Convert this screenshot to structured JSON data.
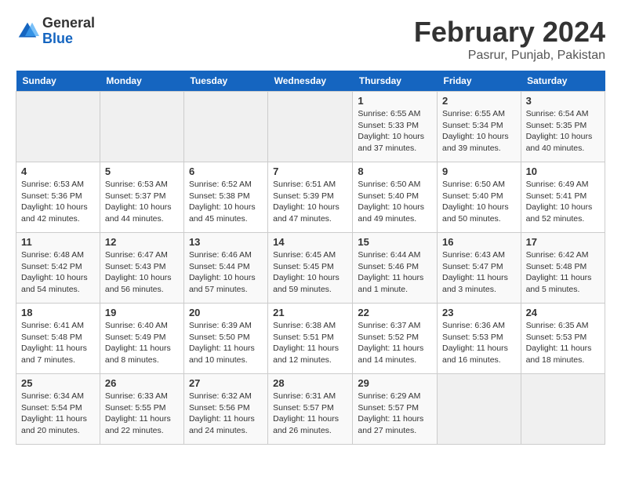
{
  "logo": {
    "general": "General",
    "blue": "Blue"
  },
  "title": "February 2024",
  "location": "Pasrur, Punjab, Pakistan",
  "headers": [
    "Sunday",
    "Monday",
    "Tuesday",
    "Wednesday",
    "Thursday",
    "Friday",
    "Saturday"
  ],
  "weeks": [
    [
      {
        "day": "",
        "info": ""
      },
      {
        "day": "",
        "info": ""
      },
      {
        "day": "",
        "info": ""
      },
      {
        "day": "",
        "info": ""
      },
      {
        "day": "1",
        "info": "Sunrise: 6:55 AM\nSunset: 5:33 PM\nDaylight: 10 hours\nand 37 minutes."
      },
      {
        "day": "2",
        "info": "Sunrise: 6:55 AM\nSunset: 5:34 PM\nDaylight: 10 hours\nand 39 minutes."
      },
      {
        "day": "3",
        "info": "Sunrise: 6:54 AM\nSunset: 5:35 PM\nDaylight: 10 hours\nand 40 minutes."
      }
    ],
    [
      {
        "day": "4",
        "info": "Sunrise: 6:53 AM\nSunset: 5:36 PM\nDaylight: 10 hours\nand 42 minutes."
      },
      {
        "day": "5",
        "info": "Sunrise: 6:53 AM\nSunset: 5:37 PM\nDaylight: 10 hours\nand 44 minutes."
      },
      {
        "day": "6",
        "info": "Sunrise: 6:52 AM\nSunset: 5:38 PM\nDaylight: 10 hours\nand 45 minutes."
      },
      {
        "day": "7",
        "info": "Sunrise: 6:51 AM\nSunset: 5:39 PM\nDaylight: 10 hours\nand 47 minutes."
      },
      {
        "day": "8",
        "info": "Sunrise: 6:50 AM\nSunset: 5:40 PM\nDaylight: 10 hours\nand 49 minutes."
      },
      {
        "day": "9",
        "info": "Sunrise: 6:50 AM\nSunset: 5:40 PM\nDaylight: 10 hours\nand 50 minutes."
      },
      {
        "day": "10",
        "info": "Sunrise: 6:49 AM\nSunset: 5:41 PM\nDaylight: 10 hours\nand 52 minutes."
      }
    ],
    [
      {
        "day": "11",
        "info": "Sunrise: 6:48 AM\nSunset: 5:42 PM\nDaylight: 10 hours\nand 54 minutes."
      },
      {
        "day": "12",
        "info": "Sunrise: 6:47 AM\nSunset: 5:43 PM\nDaylight: 10 hours\nand 56 minutes."
      },
      {
        "day": "13",
        "info": "Sunrise: 6:46 AM\nSunset: 5:44 PM\nDaylight: 10 hours\nand 57 minutes."
      },
      {
        "day": "14",
        "info": "Sunrise: 6:45 AM\nSunset: 5:45 PM\nDaylight: 10 hours\nand 59 minutes."
      },
      {
        "day": "15",
        "info": "Sunrise: 6:44 AM\nSunset: 5:46 PM\nDaylight: 11 hours\nand 1 minute."
      },
      {
        "day": "16",
        "info": "Sunrise: 6:43 AM\nSunset: 5:47 PM\nDaylight: 11 hours\nand 3 minutes."
      },
      {
        "day": "17",
        "info": "Sunrise: 6:42 AM\nSunset: 5:48 PM\nDaylight: 11 hours\nand 5 minutes."
      }
    ],
    [
      {
        "day": "18",
        "info": "Sunrise: 6:41 AM\nSunset: 5:48 PM\nDaylight: 11 hours\nand 7 minutes."
      },
      {
        "day": "19",
        "info": "Sunrise: 6:40 AM\nSunset: 5:49 PM\nDaylight: 11 hours\nand 8 minutes."
      },
      {
        "day": "20",
        "info": "Sunrise: 6:39 AM\nSunset: 5:50 PM\nDaylight: 11 hours\nand 10 minutes."
      },
      {
        "day": "21",
        "info": "Sunrise: 6:38 AM\nSunset: 5:51 PM\nDaylight: 11 hours\nand 12 minutes."
      },
      {
        "day": "22",
        "info": "Sunrise: 6:37 AM\nSunset: 5:52 PM\nDaylight: 11 hours\nand 14 minutes."
      },
      {
        "day": "23",
        "info": "Sunrise: 6:36 AM\nSunset: 5:53 PM\nDaylight: 11 hours\nand 16 minutes."
      },
      {
        "day": "24",
        "info": "Sunrise: 6:35 AM\nSunset: 5:53 PM\nDaylight: 11 hours\nand 18 minutes."
      }
    ],
    [
      {
        "day": "25",
        "info": "Sunrise: 6:34 AM\nSunset: 5:54 PM\nDaylight: 11 hours\nand 20 minutes."
      },
      {
        "day": "26",
        "info": "Sunrise: 6:33 AM\nSunset: 5:55 PM\nDaylight: 11 hours\nand 22 minutes."
      },
      {
        "day": "27",
        "info": "Sunrise: 6:32 AM\nSunset: 5:56 PM\nDaylight: 11 hours\nand 24 minutes."
      },
      {
        "day": "28",
        "info": "Sunrise: 6:31 AM\nSunset: 5:57 PM\nDaylight: 11 hours\nand 26 minutes."
      },
      {
        "day": "29",
        "info": "Sunrise: 6:29 AM\nSunset: 5:57 PM\nDaylight: 11 hours\nand 27 minutes."
      },
      {
        "day": "",
        "info": ""
      },
      {
        "day": "",
        "info": ""
      }
    ]
  ]
}
